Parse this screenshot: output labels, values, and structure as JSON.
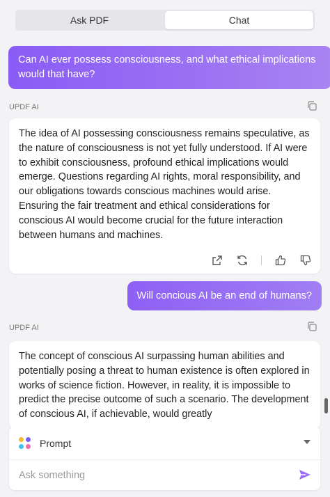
{
  "tabs": [
    {
      "label": "Ask PDF",
      "active": false
    },
    {
      "label": "Chat",
      "active": true
    }
  ],
  "messages": [
    {
      "role": "user",
      "text": "Can AI ever possess consciousness, and what ethical implications would that have?"
    },
    {
      "role": "ai",
      "label": "UPDF AI",
      "text": "The idea of AI possessing consciousness remains speculative, as the nature of consciousness is not yet fully understood. If AI were to exhibit consciousness, profound ethical implications would emerge. Questions regarding AI rights, moral responsibility, and our obligations towards conscious machines would arise. Ensuring the fair treatment and ethical considerations for conscious AI would become crucial for the future interaction between humans and machines."
    },
    {
      "role": "user",
      "text": "Will concious AI be an end of humans?"
    },
    {
      "role": "ai",
      "label": "UPDF AI",
      "text": "The concept of conscious AI surpassing human abilities and potentially posing a threat to human existence is often explored in works of science fiction. However, in reality, it is impossible to predict the precise outcome of such a scenario. The development of conscious AI, if achievable, would greatly"
    }
  ],
  "composer": {
    "mode_label": "Prompt",
    "placeholder": "Ask something"
  },
  "icons": {
    "copy": "copy-icon",
    "export": "external-link-icon",
    "regenerate": "refresh-icon",
    "like": "thumbs-up-icon",
    "dislike": "thumbs-down-icon",
    "prompt": "prompt-dots-icon",
    "send": "send-icon"
  },
  "colors": {
    "user_bubble_start": "#8a5cf6",
    "user_bubble_end": "#a884f2",
    "send": "#9b6cf5",
    "prompt_dot_1": "#f5b82e",
    "prompt_dot_2": "#7a5cf6",
    "prompt_dot_3": "#3fc1f0",
    "prompt_dot_4": "#f06ea9"
  }
}
